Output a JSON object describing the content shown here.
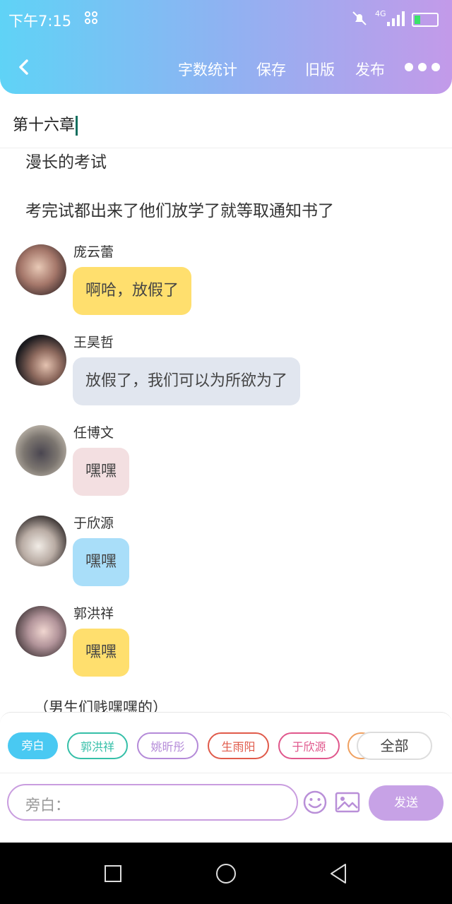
{
  "status_bar": {
    "time": "下午7:15",
    "network": "4G"
  },
  "toolbar": {
    "items": [
      "字数统计",
      "保存",
      "旧版",
      "发布"
    ]
  },
  "chapter": {
    "title": "第十六章"
  },
  "story": {
    "lines": [
      "漫长的考试",
      "考完试都出来了他们放学了就等取通知书了"
    ],
    "messages": [
      {
        "speaker": "庞云蕾",
        "text": "啊哈，放假了",
        "bubble_color": "#ffdf6e"
      },
      {
        "speaker": "王昊哲",
        "text": "放假了，我们可以为所欲为了",
        "bubble_color": "#e1e6ef"
      },
      {
        "speaker": "任博文",
        "text": "嘿嘿",
        "bubble_color": "#f3dfe1"
      },
      {
        "speaker": "于欣源",
        "text": "嘿嘿",
        "bubble_color": "#a9def9"
      },
      {
        "speaker": "郭洪祥",
        "text": "嘿嘿",
        "bubble_color": "#ffdf6e"
      }
    ],
    "cut_line": "（男生们贱嘿嘿的）"
  },
  "roles": {
    "chips": [
      {
        "label": "旁白",
        "color": "#49c9f2"
      },
      {
        "label": "郭洪祥",
        "color": "#35bfa8"
      },
      {
        "label": "姚昕彤",
        "color": "#b48ad8"
      },
      {
        "label": "生雨阳",
        "color": "#e05a4a"
      },
      {
        "label": "于欣源",
        "color": "#e0578c"
      }
    ],
    "all_label": "全部"
  },
  "composer": {
    "placeholder": "旁白：",
    "send_label": "发送"
  }
}
